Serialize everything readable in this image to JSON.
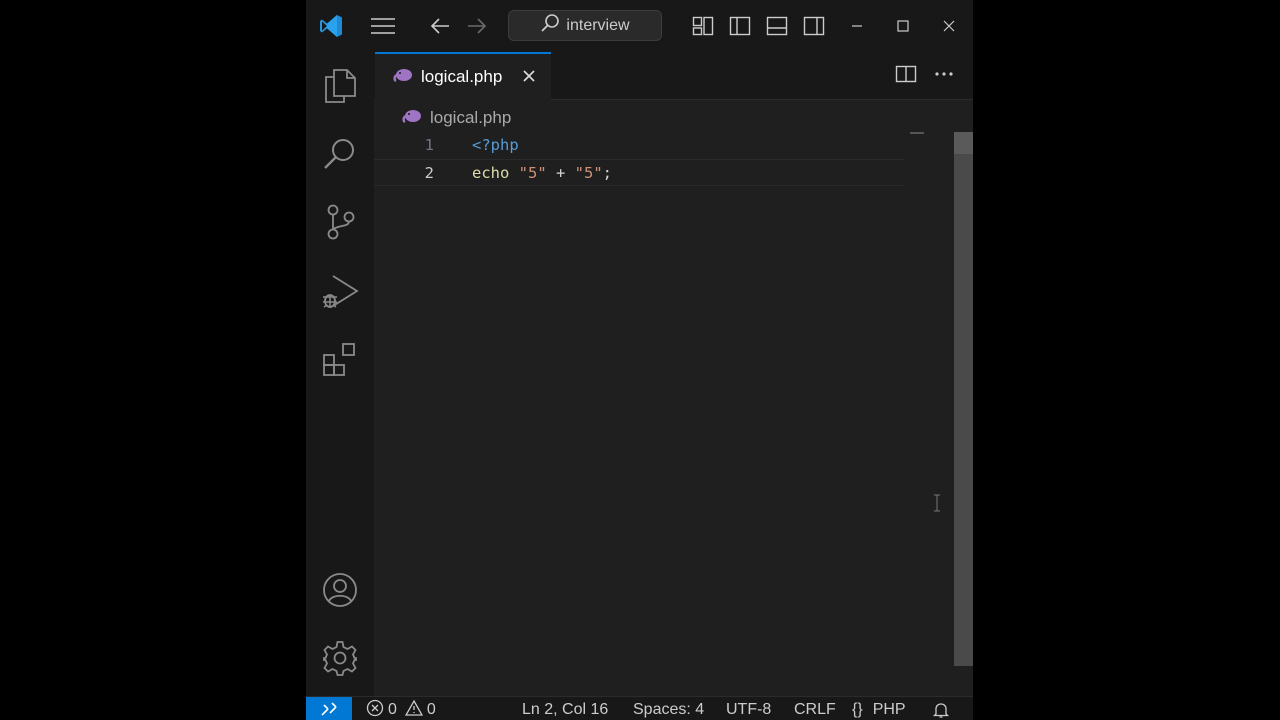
{
  "titlebar": {
    "search_text": "interview"
  },
  "tab": {
    "label": "logical.php"
  },
  "breadcrumb": {
    "file": "logical.php"
  },
  "editor": {
    "lines": [
      {
        "number": "1",
        "tag": "<?php"
      },
      {
        "number": "2",
        "keyword": "echo",
        "str1": "\"5\"",
        "op": " + ",
        "str2": "\"5\"",
        "end": ";"
      }
    ],
    "current_line": 2
  },
  "statusbar": {
    "errors": "0",
    "warnings": "0",
    "position": "Ln 2, Col 16",
    "spaces": "Spaces: 4",
    "encoding": "UTF-8",
    "eol": "CRLF",
    "language_braces": "{}",
    "language": "PHP"
  },
  "colors": {
    "accent": "#0078d4",
    "php_icon": "#a074c4",
    "background": "#1f1f1f"
  }
}
